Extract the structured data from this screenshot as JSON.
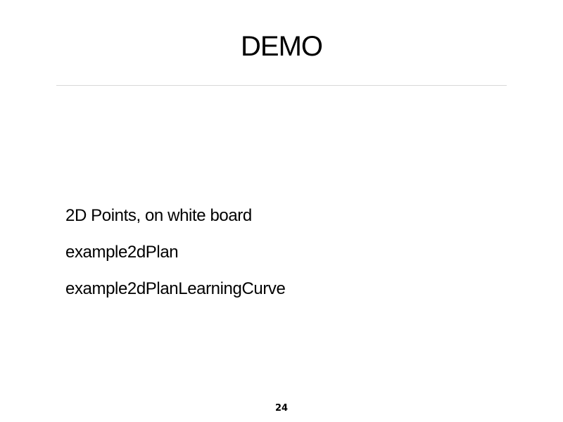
{
  "slide": {
    "title": "DEMO",
    "items": [
      "2D Points, on white board",
      "example2dPlan",
      "example2dPlanLearningCurve"
    ],
    "page_number": "24"
  },
  "colors": {
    "background": "#ffffff",
    "text": "#000000",
    "rule": "#d9d9d9"
  }
}
